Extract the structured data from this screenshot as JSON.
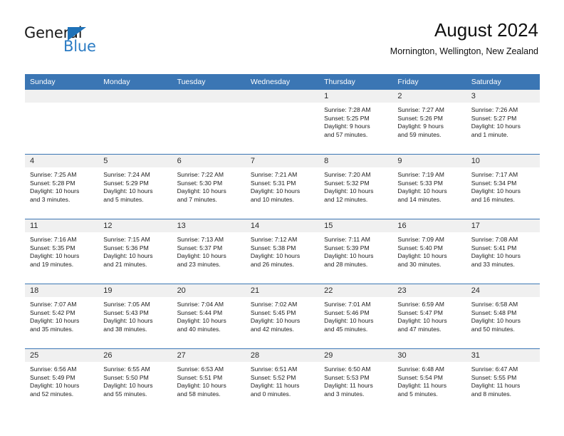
{
  "brand": {
    "name_part1": "General",
    "name_part2": "Blue"
  },
  "header": {
    "title": "August 2024",
    "subtitle": "Mornington, Wellington, New Zealand"
  },
  "colors": {
    "header_blue": "#3b76b4",
    "day_band_gray": "#f0f0f0",
    "logo_blue": "#2b7cc4",
    "text": "#1c1c1c"
  },
  "weekdays": [
    "Sunday",
    "Monday",
    "Tuesday",
    "Wednesday",
    "Thursday",
    "Friday",
    "Saturday"
  ],
  "weeks": [
    [
      {
        "day": "",
        "sunrise": "",
        "sunset": "",
        "daylight1": "",
        "daylight2": ""
      },
      {
        "day": "",
        "sunrise": "",
        "sunset": "",
        "daylight1": "",
        "daylight2": ""
      },
      {
        "day": "",
        "sunrise": "",
        "sunset": "",
        "daylight1": "",
        "daylight2": ""
      },
      {
        "day": "",
        "sunrise": "",
        "sunset": "",
        "daylight1": "",
        "daylight2": ""
      },
      {
        "day": "1",
        "sunrise": "Sunrise: 7:28 AM",
        "sunset": "Sunset: 5:25 PM",
        "daylight1": "Daylight: 9 hours",
        "daylight2": "and 57 minutes."
      },
      {
        "day": "2",
        "sunrise": "Sunrise: 7:27 AM",
        "sunset": "Sunset: 5:26 PM",
        "daylight1": "Daylight: 9 hours",
        "daylight2": "and 59 minutes."
      },
      {
        "day": "3",
        "sunrise": "Sunrise: 7:26 AM",
        "sunset": "Sunset: 5:27 PM",
        "daylight1": "Daylight: 10 hours",
        "daylight2": "and 1 minute."
      }
    ],
    [
      {
        "day": "4",
        "sunrise": "Sunrise: 7:25 AM",
        "sunset": "Sunset: 5:28 PM",
        "daylight1": "Daylight: 10 hours",
        "daylight2": "and 3 minutes."
      },
      {
        "day": "5",
        "sunrise": "Sunrise: 7:24 AM",
        "sunset": "Sunset: 5:29 PM",
        "daylight1": "Daylight: 10 hours",
        "daylight2": "and 5 minutes."
      },
      {
        "day": "6",
        "sunrise": "Sunrise: 7:22 AM",
        "sunset": "Sunset: 5:30 PM",
        "daylight1": "Daylight: 10 hours",
        "daylight2": "and 7 minutes."
      },
      {
        "day": "7",
        "sunrise": "Sunrise: 7:21 AM",
        "sunset": "Sunset: 5:31 PM",
        "daylight1": "Daylight: 10 hours",
        "daylight2": "and 10 minutes."
      },
      {
        "day": "8",
        "sunrise": "Sunrise: 7:20 AM",
        "sunset": "Sunset: 5:32 PM",
        "daylight1": "Daylight: 10 hours",
        "daylight2": "and 12 minutes."
      },
      {
        "day": "9",
        "sunrise": "Sunrise: 7:19 AM",
        "sunset": "Sunset: 5:33 PM",
        "daylight1": "Daylight: 10 hours",
        "daylight2": "and 14 minutes."
      },
      {
        "day": "10",
        "sunrise": "Sunrise: 7:17 AM",
        "sunset": "Sunset: 5:34 PM",
        "daylight1": "Daylight: 10 hours",
        "daylight2": "and 16 minutes."
      }
    ],
    [
      {
        "day": "11",
        "sunrise": "Sunrise: 7:16 AM",
        "sunset": "Sunset: 5:35 PM",
        "daylight1": "Daylight: 10 hours",
        "daylight2": "and 19 minutes."
      },
      {
        "day": "12",
        "sunrise": "Sunrise: 7:15 AM",
        "sunset": "Sunset: 5:36 PM",
        "daylight1": "Daylight: 10 hours",
        "daylight2": "and 21 minutes."
      },
      {
        "day": "13",
        "sunrise": "Sunrise: 7:13 AM",
        "sunset": "Sunset: 5:37 PM",
        "daylight1": "Daylight: 10 hours",
        "daylight2": "and 23 minutes."
      },
      {
        "day": "14",
        "sunrise": "Sunrise: 7:12 AM",
        "sunset": "Sunset: 5:38 PM",
        "daylight1": "Daylight: 10 hours",
        "daylight2": "and 26 minutes."
      },
      {
        "day": "15",
        "sunrise": "Sunrise: 7:11 AM",
        "sunset": "Sunset: 5:39 PM",
        "daylight1": "Daylight: 10 hours",
        "daylight2": "and 28 minutes."
      },
      {
        "day": "16",
        "sunrise": "Sunrise: 7:09 AM",
        "sunset": "Sunset: 5:40 PM",
        "daylight1": "Daylight: 10 hours",
        "daylight2": "and 30 minutes."
      },
      {
        "day": "17",
        "sunrise": "Sunrise: 7:08 AM",
        "sunset": "Sunset: 5:41 PM",
        "daylight1": "Daylight: 10 hours",
        "daylight2": "and 33 minutes."
      }
    ],
    [
      {
        "day": "18",
        "sunrise": "Sunrise: 7:07 AM",
        "sunset": "Sunset: 5:42 PM",
        "daylight1": "Daylight: 10 hours",
        "daylight2": "and 35 minutes."
      },
      {
        "day": "19",
        "sunrise": "Sunrise: 7:05 AM",
        "sunset": "Sunset: 5:43 PM",
        "daylight1": "Daylight: 10 hours",
        "daylight2": "and 38 minutes."
      },
      {
        "day": "20",
        "sunrise": "Sunrise: 7:04 AM",
        "sunset": "Sunset: 5:44 PM",
        "daylight1": "Daylight: 10 hours",
        "daylight2": "and 40 minutes."
      },
      {
        "day": "21",
        "sunrise": "Sunrise: 7:02 AM",
        "sunset": "Sunset: 5:45 PM",
        "daylight1": "Daylight: 10 hours",
        "daylight2": "and 42 minutes."
      },
      {
        "day": "22",
        "sunrise": "Sunrise: 7:01 AM",
        "sunset": "Sunset: 5:46 PM",
        "daylight1": "Daylight: 10 hours",
        "daylight2": "and 45 minutes."
      },
      {
        "day": "23",
        "sunrise": "Sunrise: 6:59 AM",
        "sunset": "Sunset: 5:47 PM",
        "daylight1": "Daylight: 10 hours",
        "daylight2": "and 47 minutes."
      },
      {
        "day": "24",
        "sunrise": "Sunrise: 6:58 AM",
        "sunset": "Sunset: 5:48 PM",
        "daylight1": "Daylight: 10 hours",
        "daylight2": "and 50 minutes."
      }
    ],
    [
      {
        "day": "25",
        "sunrise": "Sunrise: 6:56 AM",
        "sunset": "Sunset: 5:49 PM",
        "daylight1": "Daylight: 10 hours",
        "daylight2": "and 52 minutes."
      },
      {
        "day": "26",
        "sunrise": "Sunrise: 6:55 AM",
        "sunset": "Sunset: 5:50 PM",
        "daylight1": "Daylight: 10 hours",
        "daylight2": "and 55 minutes."
      },
      {
        "day": "27",
        "sunrise": "Sunrise: 6:53 AM",
        "sunset": "Sunset: 5:51 PM",
        "daylight1": "Daylight: 10 hours",
        "daylight2": "and 58 minutes."
      },
      {
        "day": "28",
        "sunrise": "Sunrise: 6:51 AM",
        "sunset": "Sunset: 5:52 PM",
        "daylight1": "Daylight: 11 hours",
        "daylight2": "and 0 minutes."
      },
      {
        "day": "29",
        "sunrise": "Sunrise: 6:50 AM",
        "sunset": "Sunset: 5:53 PM",
        "daylight1": "Daylight: 11 hours",
        "daylight2": "and 3 minutes."
      },
      {
        "day": "30",
        "sunrise": "Sunrise: 6:48 AM",
        "sunset": "Sunset: 5:54 PM",
        "daylight1": "Daylight: 11 hours",
        "daylight2": "and 5 minutes."
      },
      {
        "day": "31",
        "sunrise": "Sunrise: 6:47 AM",
        "sunset": "Sunset: 5:55 PM",
        "daylight1": "Daylight: 11 hours",
        "daylight2": "and 8 minutes."
      }
    ]
  ]
}
